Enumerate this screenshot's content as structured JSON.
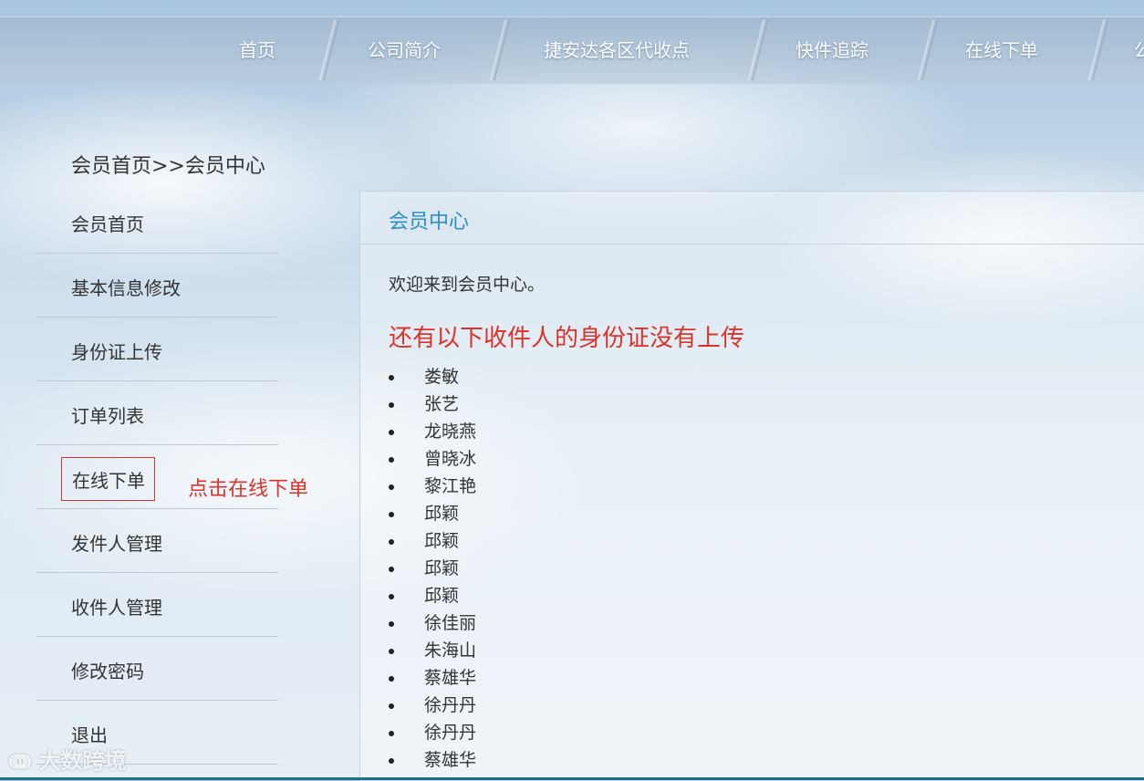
{
  "nav": {
    "items": [
      "首页",
      "公司简介",
      "捷安达各区代收点",
      "快件追踪",
      "在线下单",
      "公"
    ]
  },
  "breadcrumb": "会员首页>>会员中心",
  "sidebar": {
    "items": [
      "会员首页",
      "基本信息修改",
      "身份证上传",
      "订单列表",
      "在线下单",
      "发件人管理",
      "收件人管理",
      "修改密码",
      "退出"
    ]
  },
  "annotation": "点击在线下单",
  "panel": {
    "title": "会员中心",
    "welcome": "欢迎来到会员中心。",
    "notice": "还有以下收件人的身份证没有上传",
    "names": [
      "娄敏",
      "张艺",
      "龙晓燕",
      "曾晓冰",
      "黎江艳",
      "邱颖",
      "邱颖",
      "邱颖",
      "邱颖",
      "徐佳丽",
      "朱海山",
      "蔡雄华",
      "徐丹丹",
      "徐丹丹",
      "蔡雄华"
    ]
  },
  "watermark": "大数跨境",
  "colors": {
    "accent": "#2b8fbf",
    "alert": "#d9342b"
  }
}
